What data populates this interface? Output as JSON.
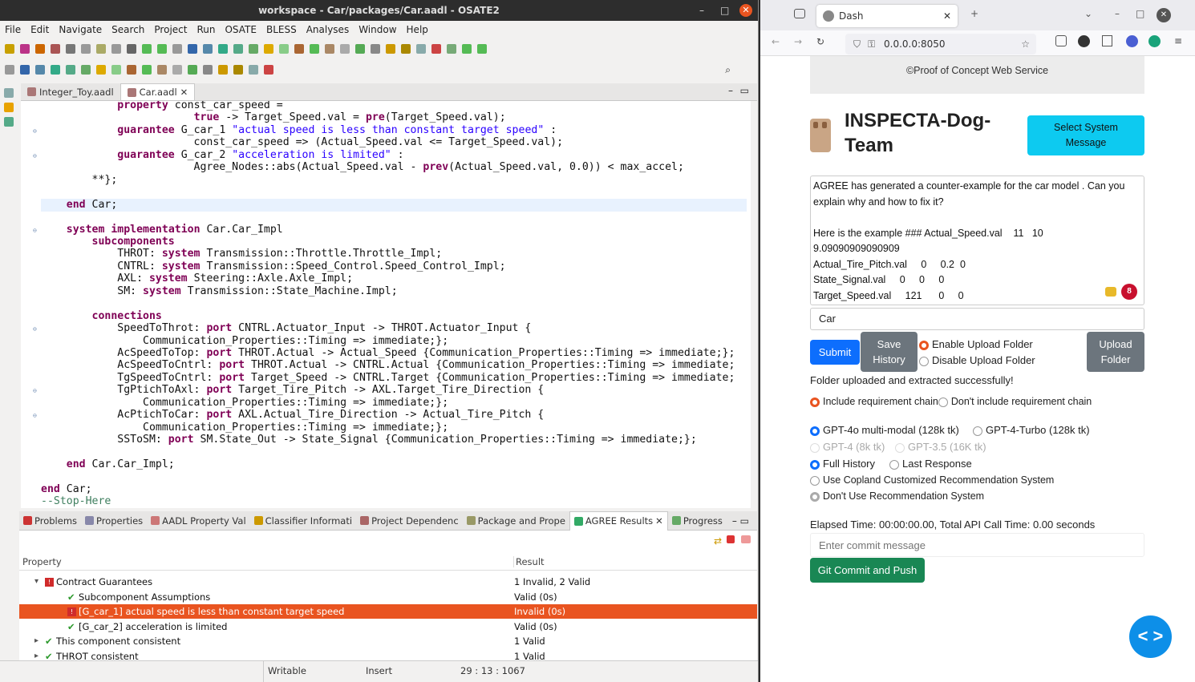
{
  "eclipse": {
    "title": "workspace - Car/packages/Car.aadl - OSATE2",
    "menu": [
      "File",
      "Edit",
      "Navigate",
      "Search",
      "Project",
      "Run",
      "OSATE",
      "BLESS",
      "Analyses",
      "Window",
      "Help"
    ],
    "editor_tabs": [
      {
        "label": "Integer_Toy.aadl"
      },
      {
        "label": "Car.aadl"
      }
    ],
    "code_lines": [
      "            property const_car_speed =",
      "                        true -> Target_Speed.val = pre(Target_Speed.val);",
      "            guarantee G_car_1 \"actual speed is less than constant target speed\" :",
      "                        const_car_speed => (Actual_Speed.val <= Target_Speed.val);",
      "            guarantee G_car_2 \"acceleration is limited\" :",
      "                        Agree_Nodes::abs(Actual_Speed.val - prev(Actual_Speed.val, 0.0)) < max_accel;",
      "        **};",
      "",
      "    end Car;",
      "",
      "    system implementation Car.Car_Impl",
      "        subcomponents",
      "            THROT: system Transmission::Throttle.Throttle_Impl;",
      "            CNTRL: system Transmission::Speed_Control.Speed_Control_Impl;",
      "            AXL: system Steering::Axle.Axle_Impl;",
      "            SM: system Transmission::State_Machine.Impl;",
      "",
      "        connections",
      "            SpeedToThrot: port CNTRL.Actuator_Input -> THROT.Actuator_Input {",
      "                Communication_Properties::Timing => immediate;};",
      "            AcSpeedToTop: port THROT.Actual -> Actual_Speed {Communication_Properties::Timing => immediate;};",
      "            AcSpeedToCntrl: port THROT.Actual -> CNTRL.Actual {Communication_Properties::Timing => immediate;",
      "            TgSpeedToCntrl: port Target_Speed -> CNTRL.Target {Communication_Properties::Timing => immediate;",
      "            TgPtichToAxl: port Target_Tire_Pitch -> AXL.Target_Tire_Direction {",
      "                Communication_Properties::Timing => immediate;};",
      "            AcPtichToCar: port AXL.Actual_Tire_Direction -> Actual_Tire_Pitch {",
      "                Communication_Properties::Timing => immediate;};",
      "            SSToSM: port SM.State_Out -> State_Signal {Communication_Properties::Timing => immediate;};",
      "",
      "    end Car.Car_Impl;",
      "",
      "end Car;",
      "--Stop-Here"
    ],
    "view_tabs": [
      "Problems",
      "Properties",
      "AADL Property Val",
      "Classifier Informati",
      "Project Dependenc",
      "Package and Prope",
      "AGREE Results",
      "Progress"
    ],
    "agree": {
      "col_property": "Property",
      "col_result": "Result",
      "rows": [
        {
          "label": "Contract Guarantees",
          "result": "1 Invalid, 2 Valid"
        },
        {
          "label": "Subcomponent Assumptions",
          "result": "Valid (0s)"
        },
        {
          "label": "[G_car_1] actual speed is less than constant target speed",
          "result": "Invalid (0s)"
        },
        {
          "label": "[G_car_2] acceleration is limited",
          "result": "Valid (0s)"
        },
        {
          "label": "This component consistent",
          "result": "1 Valid"
        },
        {
          "label": "THROT consistent",
          "result": "1 Valid"
        }
      ]
    },
    "status": {
      "writable": "Writable",
      "insert": "Insert",
      "position": "29 : 13 : 1067"
    }
  },
  "firefox": {
    "tab_title": "Dash",
    "url": "0.0.0.0:8050",
    "page": {
      "banner": "©Proof of Concept Web Service",
      "heading_line1": "INSPECTA-Dog-",
      "heading_line2": "Team",
      "select_btn_1": "Select System",
      "select_btn_2": "Message",
      "textarea_lines": [
        "AGREE has generated a counter-example for the car model . Can you",
        "explain why and how to fix it?",
        "",
        "Here is the example ### Actual_Speed.val    11   10",
        "9.09090909090909",
        "Actual_Tire_Pitch.val     0     0.2  0",
        "State_Signal.val     0     0     0",
        "Target_Speed.val     121      0     0"
      ],
      "model_input": "Car",
      "submit": "Submit",
      "save_1": "Save",
      "save_2": "History",
      "enable_upload": "Enable Upload Folder",
      "disable_upload": "Disable Upload Folder",
      "upload_1": "Upload",
      "upload_2": "Folder",
      "upload_msg": "Folder uploaded and extracted successfully!",
      "req_include": "Include requirement chain",
      "req_exclude": "Don't include requirement chain",
      "models": [
        "GPT-4o multi-modal (128k tk)",
        "GPT-4-Turbo (128k tk)",
        "GPT-4 (8k tk)",
        "GPT-3.5 (16K tk)"
      ],
      "history_full": "Full History",
      "history_last": "Last Response",
      "rec_use": "Use Copland Customized Recommendation System",
      "rec_dont": "Don't Use Recommendation System",
      "elapsed": "Elapsed Time: 00:00:00.00, Total API Call Time: 0.00 seconds",
      "commit_placeholder": "Enter commit message",
      "commit_btn": "Git Commit and Push",
      "badge": "8",
      "fab": "< >"
    }
  },
  "colors": {
    "accent": "#e95420",
    "primary": "#0d6efd",
    "cyan": "#0dcaf0",
    "gray": "#6c757d",
    "green": "#198754"
  }
}
